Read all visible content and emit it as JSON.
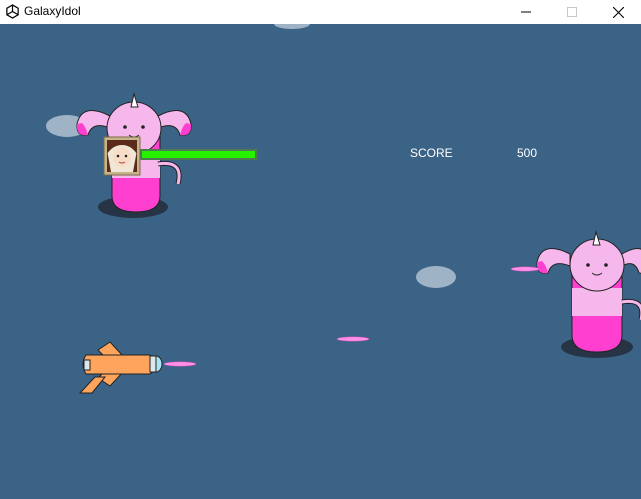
{
  "window": {
    "title": "GalaxyIdol",
    "controls": [
      "minimize",
      "maximize",
      "close"
    ]
  },
  "hud": {
    "score_label": "SCORE",
    "score_value": "500",
    "health_fraction": 1.0
  },
  "colors": {
    "sky": "#3b6386",
    "health_bar": "#26f200",
    "monster_pink": "#f6b8ec",
    "monster_magenta": "#ff3fd0",
    "ship_orange": "#ffa45c",
    "laser_pink": "#ff8fe8",
    "rock_gray": "#9fb3c6"
  },
  "icons": {
    "app": "unity-logo-icon",
    "player": "spaceship-icon",
    "enemy": "pink-rabbit-monster-icon",
    "portrait": "idol-portrait-icon"
  }
}
